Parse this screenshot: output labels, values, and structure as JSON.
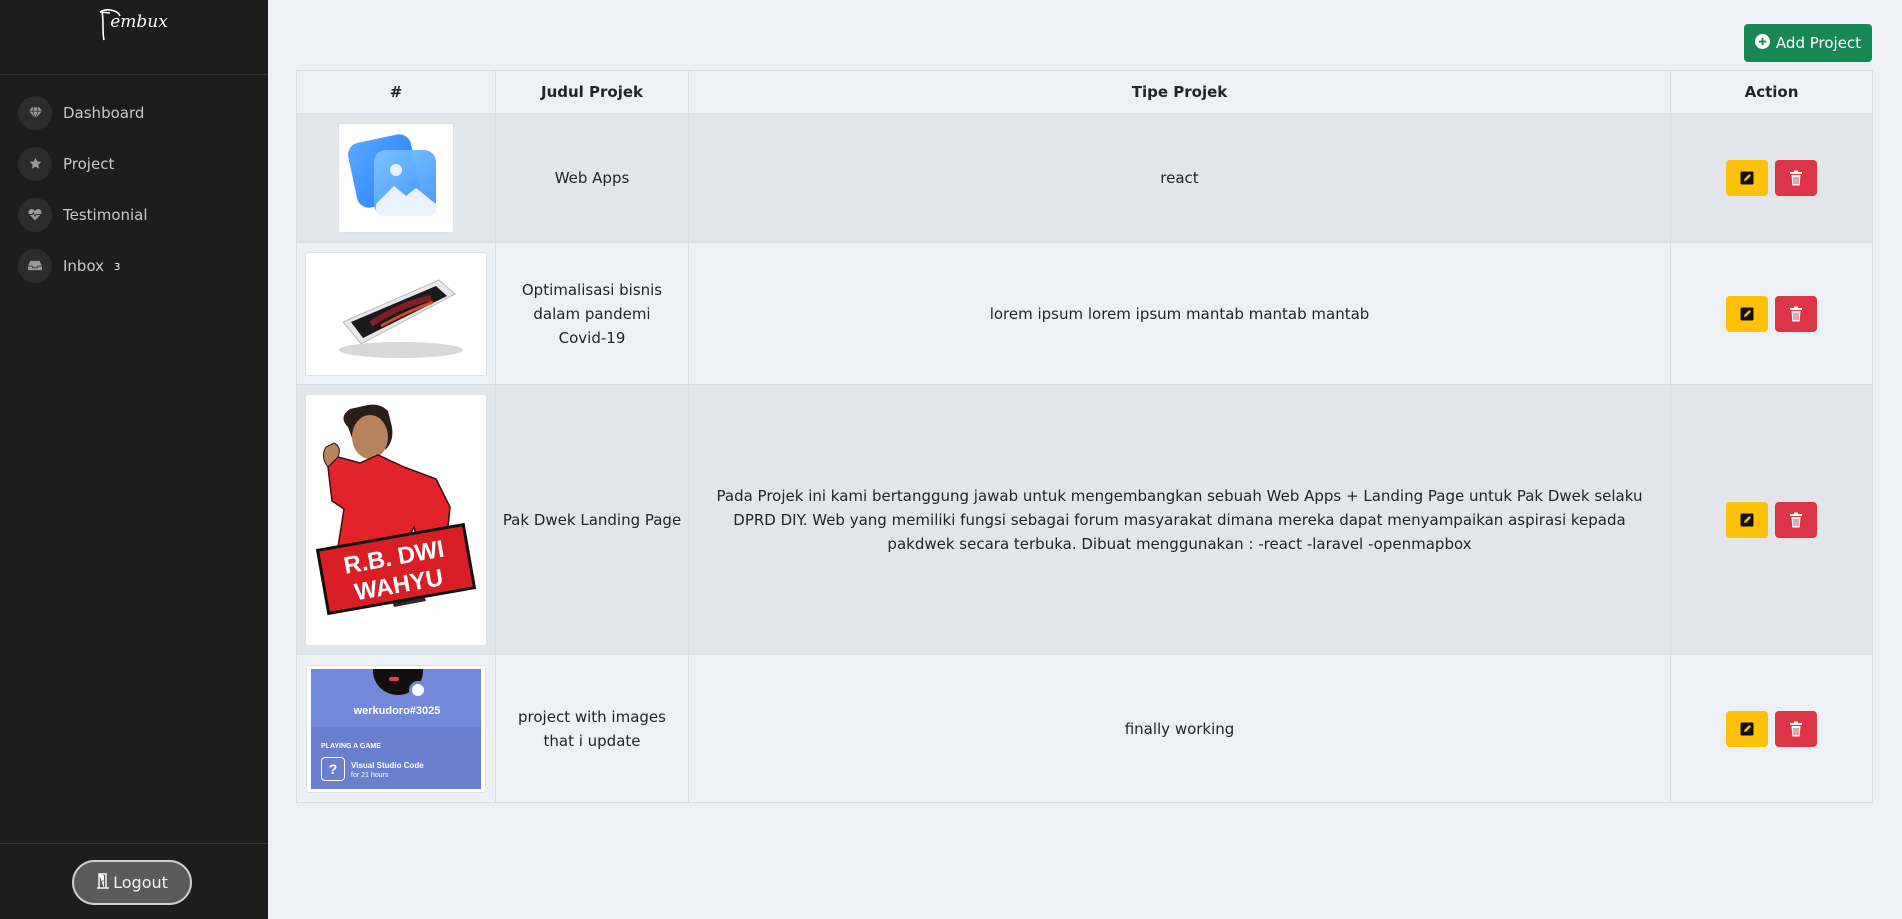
{
  "sidebar": {
    "logo_text": "embux",
    "items": [
      {
        "label": "Dashboard",
        "icon": "gem-icon"
      },
      {
        "label": "Project",
        "icon": "star-icon"
      },
      {
        "label": "Testimonial",
        "icon": "heart-pulse-icon"
      },
      {
        "label": "Inbox",
        "icon": "inbox-icon",
        "badge": "3"
      }
    ],
    "logout_label": "Logout"
  },
  "toolbar": {
    "add_label": "Add Project"
  },
  "table": {
    "headers": [
      "#",
      "Judul Projek",
      "Tipe Projek",
      "Action"
    ],
    "rows": [
      {
        "title": "Web Apps",
        "type": "react"
      },
      {
        "title": "Optimalisasi bisnis dalam pandemi Covid-19",
        "type": "lorem ipsum lorem ipsum mantab mantab mantab"
      },
      {
        "title": "Pak Dwek Landing Page",
        "type": "Pada Projek ini kami bertanggung jawab untuk mengembangkan sebuah Web Apps + Landing Page untuk Pak Dwek selaku DPRD DIY. Web yang memiliki fungsi sebagai forum masyarakat dimana mereka dapat menyampaikan aspirasi kepada pakdwek secara terbuka. Dibuat menggunakan : -react -laravel -openmapbox",
        "poster_text": [
          "R.B. DWI",
          "WAHYU"
        ]
      },
      {
        "title": "project with images that i update",
        "type": "finally working",
        "card": {
          "user": "werkudoro#3025",
          "status": "PLAYING A GAME",
          "game": "Visual Studio Code",
          "duration": "for 21 hours"
        }
      }
    ]
  },
  "colors": {
    "sidebar_bg": "#1d1d1d",
    "add_button": "#198754",
    "edit_button": "#ffc107",
    "delete_button": "#dc3545"
  }
}
